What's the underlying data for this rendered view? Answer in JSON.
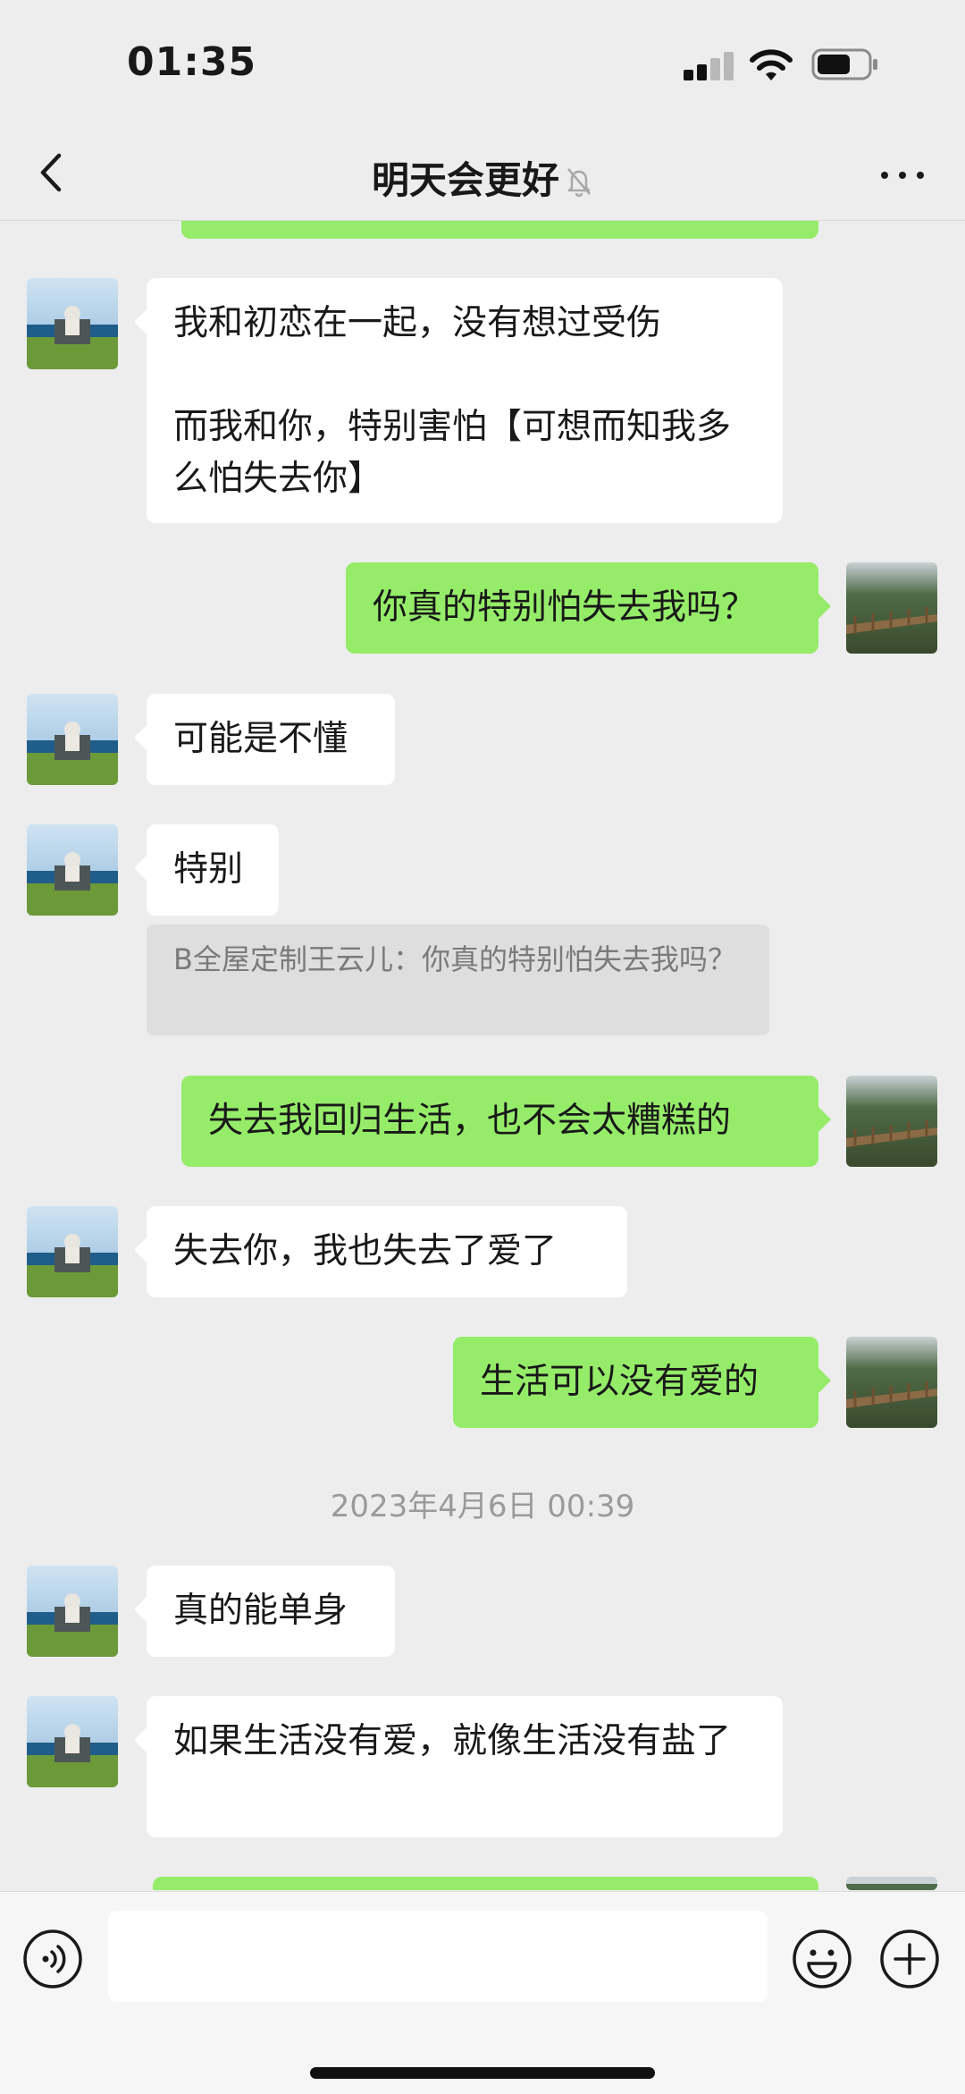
{
  "status_bar": {
    "time": "01:35"
  },
  "header": {
    "title": "明天会更好",
    "muted": true
  },
  "messages": [
    {
      "direction": "in",
      "text": "我和初恋在一起，没有想过受伤\n\n而我和你，特别害怕【可想而知我多么怕失去你】"
    },
    {
      "direction": "out",
      "text": "你真的特别怕失去我吗？"
    },
    {
      "direction": "in",
      "text": "可能是不懂"
    },
    {
      "direction": "in",
      "text": "特别",
      "quote": "B全屋定制王云儿：你真的特别怕失去我吗？"
    },
    {
      "direction": "out",
      "text": "失去我回归生活，也不会太糟糕的"
    },
    {
      "direction": "in",
      "text": "失去你，我也失去了爱了"
    },
    {
      "direction": "out",
      "text": "生活可以没有爱的"
    },
    {
      "type": "timestamp",
      "text": "2023年4月6日 00:39"
    },
    {
      "direction": "in",
      "text": "真的能单身"
    },
    {
      "direction": "in",
      "text": "如果生活没有爱，就像生活没有盐了"
    }
  ],
  "input": {
    "placeholder": "",
    "value": ""
  },
  "colors": {
    "outgoing_bubble": "#95ec69",
    "incoming_bubble": "#ffffff",
    "background": "#ededed"
  },
  "icons": {
    "back": "chevron-left-icon",
    "mute": "bell-slash-icon",
    "more": "ellipsis-icon",
    "voice": "voice-icon",
    "emoji": "emoji-icon",
    "plus": "plus-icon"
  }
}
